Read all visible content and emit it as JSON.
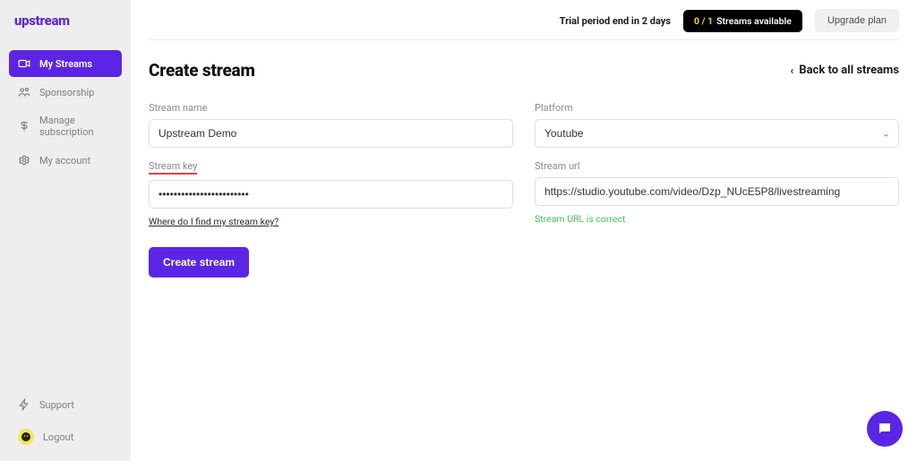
{
  "brand": {
    "name": "upstream"
  },
  "sidebar": {
    "items": [
      {
        "label": "My Streams",
        "icon": "camera-icon"
      },
      {
        "label": "Sponsorship",
        "icon": "users-icon"
      },
      {
        "label": "Manage subscription",
        "icon": "dollar-icon"
      },
      {
        "label": "My account",
        "icon": "gear-icon"
      }
    ],
    "bottom": [
      {
        "label": "Support",
        "icon": "bolt-icon"
      },
      {
        "label": "Logout",
        "icon": "avatar-icon"
      }
    ]
  },
  "topbar": {
    "trial_text": "Trial period end in 2 days",
    "streams_count": "0 / 1",
    "streams_label": "Streams available",
    "upgrade_label": "Upgrade plan"
  },
  "page": {
    "title": "Create stream",
    "back_label": "Back to all streams"
  },
  "form": {
    "stream_name": {
      "label": "Stream name",
      "value": "Upstream Demo"
    },
    "platform": {
      "label": "Platform",
      "value": "Youtube"
    },
    "stream_key": {
      "label": "Stream key",
      "value": "••••••••••••••••••••••••",
      "help": "Where do I find my stream key?"
    },
    "stream_url": {
      "label": "Stream url",
      "value": "https://studio.youtube.com/video/Dzp_NUcE5P8/livestreaming",
      "hint": "Stream URL is correct"
    },
    "submit_label": "Create stream"
  },
  "fab": {
    "name": "chat-icon"
  }
}
